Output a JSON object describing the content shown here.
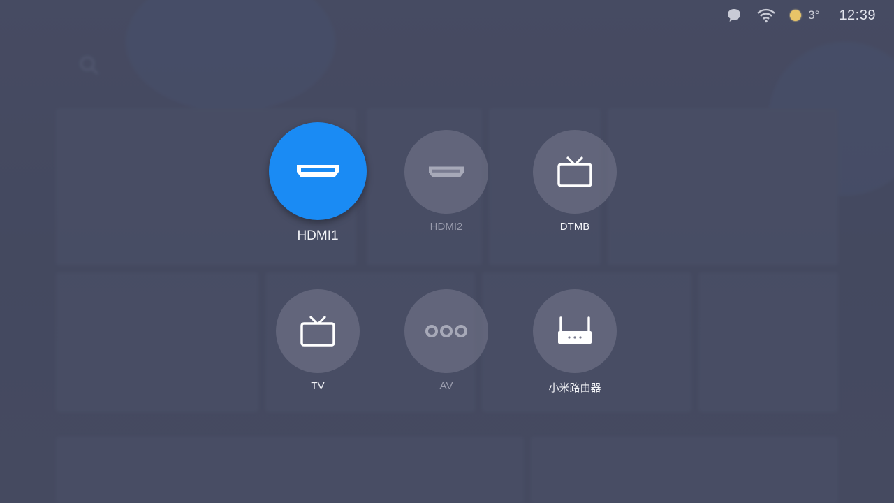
{
  "status_bar": {
    "icons": [
      "message-icon",
      "wifi-icon",
      "weather-sun-icon"
    ],
    "temperature": "3°",
    "time": "12:39"
  },
  "sources": [
    {
      "id": "hdmi1",
      "label": "HDMI1",
      "icon": "hdmi-icon",
      "focused": true,
      "enabled": true
    },
    {
      "id": "hdmi2",
      "label": "HDMI2",
      "icon": "hdmi-icon",
      "focused": false,
      "enabled": false
    },
    {
      "id": "dtmb",
      "label": "DTMB",
      "icon": "tv-icon",
      "focused": false,
      "enabled": true
    },
    {
      "id": "tv",
      "label": "TV",
      "icon": "tv-icon",
      "focused": false,
      "enabled": true
    },
    {
      "id": "av",
      "label": "AV",
      "icon": "av-dots-icon",
      "focused": false,
      "enabled": false
    },
    {
      "id": "router",
      "label": "小米路由器",
      "icon": "router-icon",
      "focused": false,
      "enabled": true
    }
  ],
  "colors": {
    "focus_accent": "#1a8bf4",
    "icon_active": "#ffffff",
    "icon_dim": "#a7a9b8",
    "weather_sun": "#e8c468"
  }
}
